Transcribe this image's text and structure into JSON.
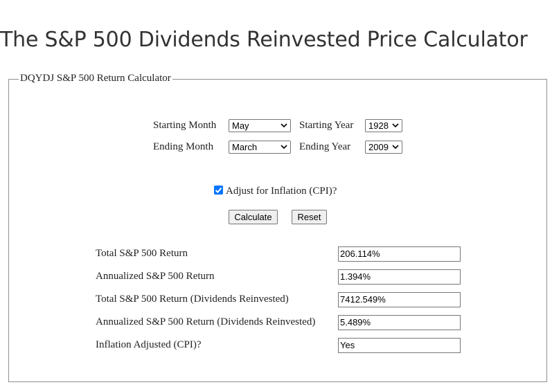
{
  "page": {
    "title": "The S&P 500 Dividends Reinvested Price Calculator"
  },
  "calculator": {
    "legend": "DQYDJ S&P 500 Return Calculator",
    "starting_month_label": "Starting Month",
    "starting_month_value": "May",
    "starting_year_label": "Starting Year",
    "starting_year_value": "1928",
    "ending_month_label": "Ending Month",
    "ending_month_value": "March",
    "ending_year_label": "Ending Year",
    "ending_year_value": "2009",
    "inflation_checkbox_label": "Adjust for Inflation (CPI)?",
    "inflation_checked": true,
    "calculate_label": "Calculate",
    "reset_label": "Reset"
  },
  "results": [
    {
      "label": "Total S&P 500 Return",
      "value": "206.114%"
    },
    {
      "label": "Annualized S&P 500 Return",
      "value": "1.394%"
    },
    {
      "label": "Total S&P 500 Return (Dividends Reinvested)",
      "value": "7412.549%"
    },
    {
      "label": "Annualized S&P 500 Return (Dividends Reinvested)",
      "value": "5.489%"
    },
    {
      "label": "Inflation Adjusted (CPI)?",
      "value": "Yes"
    }
  ],
  "colors": {
    "checkbox_accent": "#0075ff",
    "border": "#767676",
    "title_text": "#333333"
  }
}
